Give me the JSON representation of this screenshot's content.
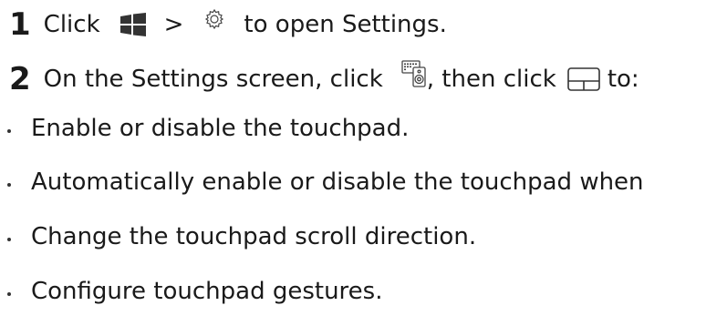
{
  "steps": [
    {
      "number": "1",
      "parts": {
        "click": "Click",
        "sep": ">",
        "rest": "to open Settings."
      },
      "icons": [
        "windows-start-icon",
        "settings-gear-icon"
      ]
    },
    {
      "number": "2",
      "parts": {
        "lead": "On the Settings screen, click",
        "mid": ", then click",
        "rest": "to:"
      },
      "icons": [
        "devices-icon",
        "touchpad-icon"
      ]
    }
  ],
  "bullets": [
    "Enable or disable the touchpad.",
    "Automatically enable or disable the touchpad when",
    "Change the touchpad scroll direction.",
    "Configure touchpad gestures."
  ],
  "colors": {
    "text": "#1a1a1a",
    "icon": "#333333"
  }
}
